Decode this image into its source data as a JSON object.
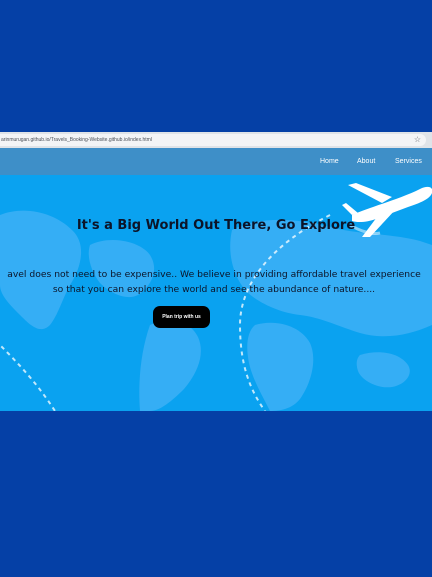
{
  "browser": {
    "url": "arinmurugan.github.io/Travels_Booking-Website.github.io/index.html",
    "bookmark_icon": "star-icon"
  },
  "nav": {
    "items": [
      {
        "label": "Home"
      },
      {
        "label": "About"
      },
      {
        "label": "Services"
      }
    ]
  },
  "hero": {
    "headline": "It's a Big World Out There, Go Explore",
    "line1": "avel does not need to be expensive.. We believe in providing affordable travel experience",
    "line2": "so that you can explore the world and see the abundance of nature....",
    "cta_label": "Plan trip with us",
    "background_icon": "world-map-airplane-illustration"
  },
  "colors": {
    "page_bg": "#0540a6",
    "navbar": "#3e8fc8",
    "hero_bg": "#0aa2f0",
    "cta_bg": "#000000"
  }
}
